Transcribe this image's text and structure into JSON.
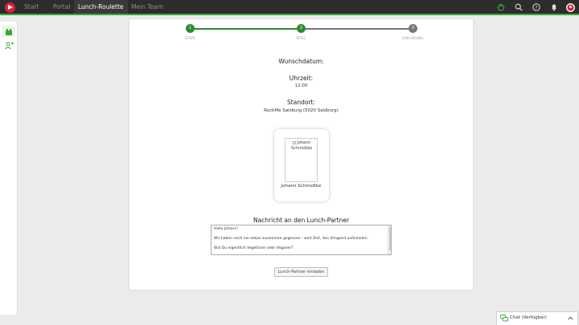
{
  "nav": {
    "items": [
      {
        "label": "Start",
        "active": false
      },
      {
        "label": "Portal",
        "active": false
      },
      {
        "label": "Lunch-Roulette",
        "active": true
      },
      {
        "label": "Mein Team",
        "active": false
      }
    ],
    "icons": [
      "power-icon",
      "search-icon",
      "help-icon",
      "bell-icon",
      "user-avatar"
    ]
  },
  "sidebar": {
    "items": [
      {
        "icon": "lunch-icon",
        "active": true
      },
      {
        "icon": "add-user-icon",
        "active": false
      }
    ]
  },
  "steps": [
    {
      "number": "1",
      "label": "START",
      "status": "done"
    },
    {
      "number": "2",
      "label": "SPIEL",
      "status": "active"
    },
    {
      "number": "3",
      "label": "EINLADUNG",
      "status": "pending"
    }
  ],
  "details": {
    "date_label": "Wunschdatum:",
    "time_label": "Uhrzeit:",
    "time_value": "12:00",
    "location_label": "Standort:",
    "location_value": "RockMe Salzburg (5020 Salzburg)"
  },
  "partner": {
    "image_alt": "Johann Schmidtke",
    "name": "Johann Schmidtke"
  },
  "message": {
    "heading": "Nachricht an den Lunch-Partner",
    "line1": "Hallo Johann!",
    "line2": "Wir haben noch nie etwas zusammen gegessen - wird Zeit, das dringend aufzuholen.",
    "line3": "Bist Du eigentlich Vegetarier oder Veganer?"
  },
  "invite_button": "Lunch-Partner einladen",
  "chat": {
    "label": "Chat (Verfügbar)"
  },
  "colors": {
    "accent": "#3ba83b",
    "step_done": "#2e8b2e",
    "step_pending": "#777777",
    "brand_red": "#d9223a",
    "topbar": "#2c2c2c"
  }
}
